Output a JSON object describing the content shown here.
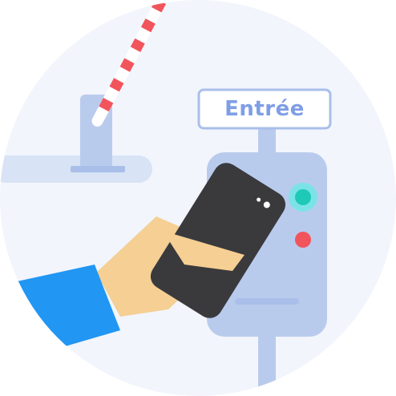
{
  "sign": {
    "label": "Entrée"
  },
  "colors": {
    "background_circle": "#f2f5fc",
    "ground_stripe": "#d8e3f5",
    "terminal_body": "#b9cbed",
    "terminal_outline": "#a9bfea",
    "sign_border": "#a9bfea",
    "sign_text": "#7f9ee6",
    "barrier_red": "#f2545b",
    "barrier_white": "#ffffff",
    "led_active": "#1ec9b7",
    "led_active_glow": "#7be3e6",
    "led_alert": "#f2545b",
    "phone_body": "#3a3a3d",
    "hand_skin": "#f5cf93",
    "sleeve": "#2196f3"
  },
  "icons": {
    "barrier": "boom-barrier-icon",
    "terminal": "nfc-terminal-icon",
    "phone": "smartphone-icon",
    "hand": "hand-icon"
  }
}
